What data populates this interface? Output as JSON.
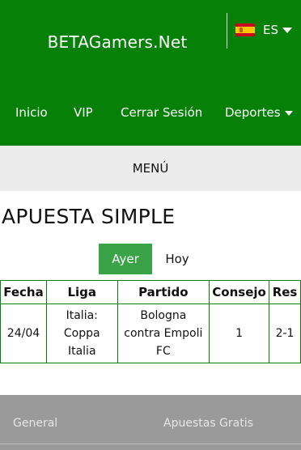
{
  "header": {
    "site_title": "BETAGamers.Net",
    "language": {
      "code": "ES",
      "flag": "spain-flag-icon"
    },
    "colors": {
      "header_bg": "#068006",
      "active_button": "#3aa348"
    }
  },
  "nav": {
    "items": [
      "Inicio",
      "VIP",
      "Cerrar Sesión",
      "Deportes"
    ]
  },
  "menu": {
    "label": "MENÚ"
  },
  "page": {
    "title": "APUESTA SIMPLE",
    "day_tabs": {
      "yesterday": "Ayer",
      "today": "Hoy",
      "selected": "Ayer"
    }
  },
  "table": {
    "headers": [
      "Fecha",
      "Liga",
      "Partido",
      "Consejo",
      "Res"
    ],
    "rows": [
      {
        "fecha": "24/04",
        "liga": [
          "Italia:",
          "Coppa",
          "Italia"
        ],
        "partido": [
          "Bologna",
          "contra Empoli",
          "FC"
        ],
        "consejo": "1",
        "res": "2-1"
      }
    ]
  },
  "footer": {
    "items": [
      "General",
      "Apuestas Gratis"
    ]
  }
}
